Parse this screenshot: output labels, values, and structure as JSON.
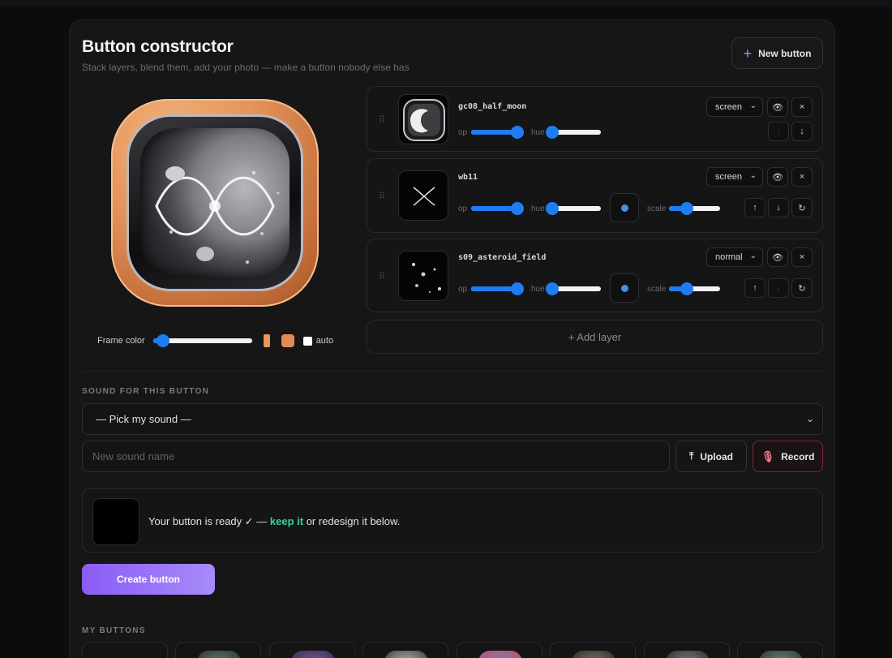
{
  "header": {
    "title": "Button constructor",
    "subtitle": "Stack layers, blend them, add your photo — make a button nobody else has",
    "new_button_label": "New button"
  },
  "frame": {
    "label": "Frame color",
    "hue_value": 0.1,
    "color": "#e68a55",
    "auto_label": "auto",
    "auto_checked": false
  },
  "layers": [
    {
      "name": "gc08_half_moon",
      "blend": "screen",
      "opacity": 0.9,
      "hue": 0.05,
      "op_label": "op",
      "hue_label": "hue",
      "move_up_enabled": false,
      "move_down_enabled": true
    },
    {
      "name": "wb11",
      "blend": "screen",
      "opacity": 0.9,
      "hue": 0.05,
      "scale": 0.35,
      "op_label": "op",
      "hue_label": "hue",
      "scale_label": "scale",
      "tint_color": "#4a90e8",
      "move_up_enabled": true,
      "move_down_enabled": true
    },
    {
      "name": "s09_asteroid_field",
      "blend": "normal",
      "opacity": 0.9,
      "hue": 0.05,
      "scale": 0.35,
      "op_label": "op",
      "hue_label": "hue",
      "scale_label": "scale",
      "tint_color": "#4a90e8",
      "move_up_enabled": true,
      "move_down_enabled": false
    }
  ],
  "add_layer_label": "+ Add layer",
  "sound": {
    "section_label": "SOUND FOR THIS BUTTON",
    "select_value": "— Pick my sound —",
    "name_placeholder": "New sound name",
    "upload_label": "Upload",
    "record_label": "Record"
  },
  "ready": {
    "prefix": "Your button is ready ✓ — ",
    "keep_label": "keep it",
    "suffix": " or redesign it below."
  },
  "create_button_label": "Create button",
  "my_buttons": {
    "section_label": "MY BUTTONS"
  },
  "icons": {
    "eye": "eye-icon",
    "close": "close-icon",
    "up": "arrow-up-icon",
    "down": "arrow-down-icon",
    "reset": "reset-icon",
    "upload": "upload-icon",
    "mic": "microphone-icon",
    "grip": "drag-handle-icon"
  },
  "colors": {
    "accent": "#8b5cf6",
    "slider": "#1f7cf2",
    "keep": "#34d399",
    "record": "#f07a8a"
  }
}
